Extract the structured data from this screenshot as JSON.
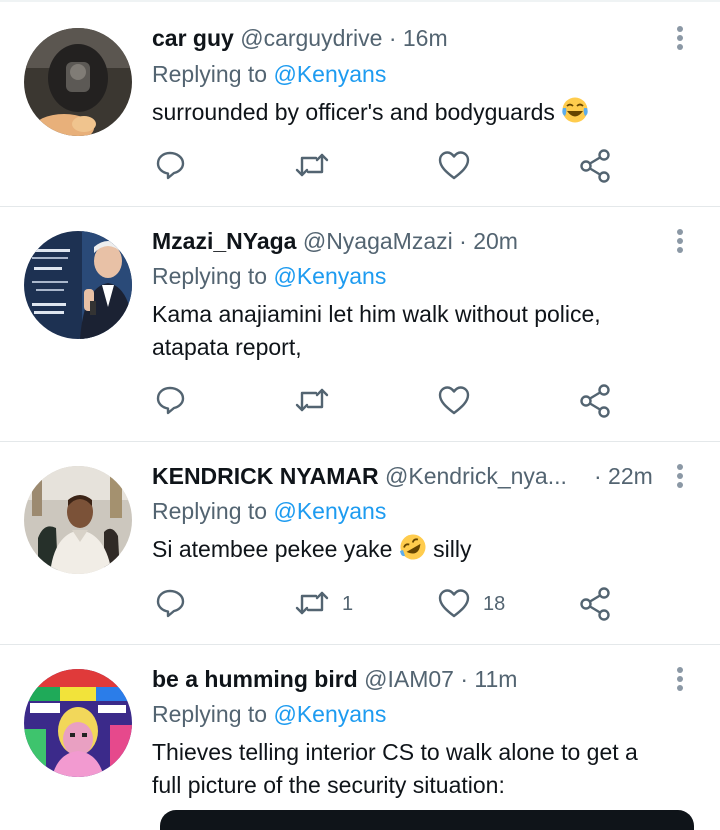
{
  "tweets": [
    {
      "name": "car guy",
      "handle": "@carguydrive",
      "time": "· 16m",
      "replying_label": "Replying to",
      "replying_handle": "@Kenyans",
      "text": "surrounded by officer's and bodyguards",
      "emoji": "face-with-tears-of-joy",
      "retweets": "",
      "likes": ""
    },
    {
      "name": "Mzazi_NYaga",
      "handle": "@NyagaMzazi",
      "time": "· 20m",
      "replying_label": "Replying to",
      "replying_handle": "@Kenyans",
      "text_line1": "Kama anajiamini let him walk without police,",
      "text_line2": "atapata report,",
      "retweets": "",
      "likes": ""
    },
    {
      "name": "KENDRICK NYAMAR",
      "handle": "@Kendrick_nya...",
      "time": "· 22m",
      "replying_label": "Replying to",
      "replying_handle": "@Kenyans",
      "text_before": "Si atembee pekee yake",
      "emoji": "rolling-on-the-floor-laughing",
      "text_after": "silly",
      "retweets": "1",
      "likes": "18"
    },
    {
      "name": "be a humming bird",
      "handle": "@IAM07",
      "time": "· 11m",
      "replying_label": "Replying to",
      "replying_handle": "@Kenyans",
      "text_line1": "Thieves telling interior CS to walk alone to get a",
      "text_line2": "full picture of the security situation:",
      "retweets": "",
      "likes": ""
    }
  ],
  "icons": {
    "reply": "reply-icon",
    "retweet": "retweet-icon",
    "like": "heart-icon",
    "share": "share-icon",
    "more": "more-vertical-icon"
  },
  "colors": {
    "link": "#1d9bf0",
    "secondary_text": "#536471",
    "icon": "#536471"
  }
}
